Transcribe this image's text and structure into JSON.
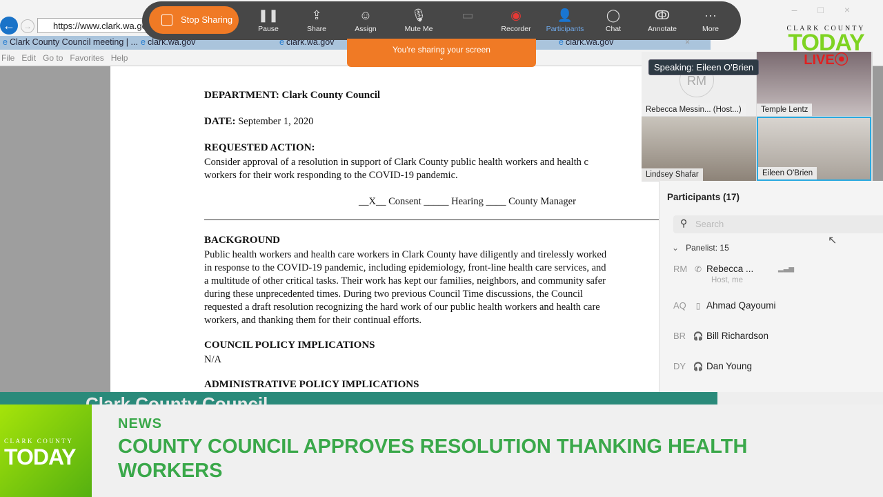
{
  "browser": {
    "url": "https://www.clark.wa.gov",
    "tabs": [
      "Clark County Council meeting | ...",
      "clark.wa.gov",
      "clark.wa.gov",
      "clark.wa.gov"
    ],
    "menu": [
      "File",
      "Edit",
      "Go to",
      "Favorites",
      "Help"
    ]
  },
  "toolbar": {
    "stop_sharing": "Stop Sharing",
    "buttons": [
      {
        "label": "Pause",
        "icon": "pause-icon"
      },
      {
        "label": "Share",
        "icon": "share-icon"
      },
      {
        "label": "Assign",
        "icon": "assign-icon"
      },
      {
        "label": "Mute Me",
        "icon": "mic-muted-icon"
      },
      {
        "label": "",
        "icon": "video-off-icon"
      },
      {
        "label": "Recorder",
        "icon": "record-icon"
      },
      {
        "label": "Participants",
        "icon": "participants-icon"
      },
      {
        "label": "Chat",
        "icon": "chat-icon"
      },
      {
        "label": "Annotate",
        "icon": "annotate-icon"
      },
      {
        "label": "More",
        "icon": "more-icon"
      }
    ],
    "sharing_banner": "You're sharing your screen",
    "accent": "#f07a25"
  },
  "logo_top": {
    "line1": "CLARK COUNTY",
    "line2": "TODAY",
    "line3": "LIVE"
  },
  "document": {
    "dept_label": "DEPARTMENT:",
    "dept": "Clark County Council",
    "date_label": "DATE:",
    "date": "September 1, 2020",
    "requested_label": "REQUESTED ACTION:",
    "requested_lines": [
      "Consider approval of a resolution in support of Clark County public health workers and health c",
      "workers for their work responding to the COVID-19 pandemic."
    ],
    "options": "__X__ Consent _____ Hearing ____ County Manager",
    "background_label": "BACKGROUND",
    "background_lines": [
      "Public health workers and health care workers in Clark County have diligently and tirelessly worked",
      "in response to the COVID-19 pandemic, including epidemiology, front-line health care services, and",
      "a multitude of other critical tasks. Their work has kept our families, neighbors, and community safer",
      "during these unprecedented times. During two previous Council Time discussions, the Council",
      "requested a draft resolution recognizing the hard work of our public health workers and health care",
      "workers, and thanking them for their continual efforts."
    ],
    "council_label": "COUNCIL POLICY IMPLICATIONS",
    "council_value": "N/A",
    "admin_label": "ADMINISTRATIVE POLICY IMPLICATIONS"
  },
  "video": {
    "speaking": "Speaking: Eileen O'Brien",
    "tiles": [
      {
        "name": "Rebecca Messin... (Host...)",
        "initials": "RM"
      },
      {
        "name": "Temple Lentz"
      },
      {
        "name": "Lindsey Shafar"
      },
      {
        "name": "Eileen O'Brien"
      }
    ]
  },
  "participants": {
    "title": "Participants (17)",
    "search_placeholder": "Search",
    "group": "Panelist: 15",
    "list": [
      {
        "initials": "RM",
        "name": "Rebecca ...",
        "sub": "Host, me"
      },
      {
        "initials": "AQ",
        "name": "Ahmad Qayoumi"
      },
      {
        "initials": "BR",
        "name": "Bill Richardson"
      },
      {
        "initials": "DY",
        "name": "Dan Young"
      }
    ]
  },
  "lower_third": {
    "strip_text": "Clark County Council",
    "logo_line1": "CLARK COUNTY",
    "logo_line2": "TODAY",
    "category": "NEWS",
    "headline": "COUNTY COUNCIL APPROVES RESOLUTION THANKING HEALTH WORKERS",
    "color": "#3aa84a"
  }
}
